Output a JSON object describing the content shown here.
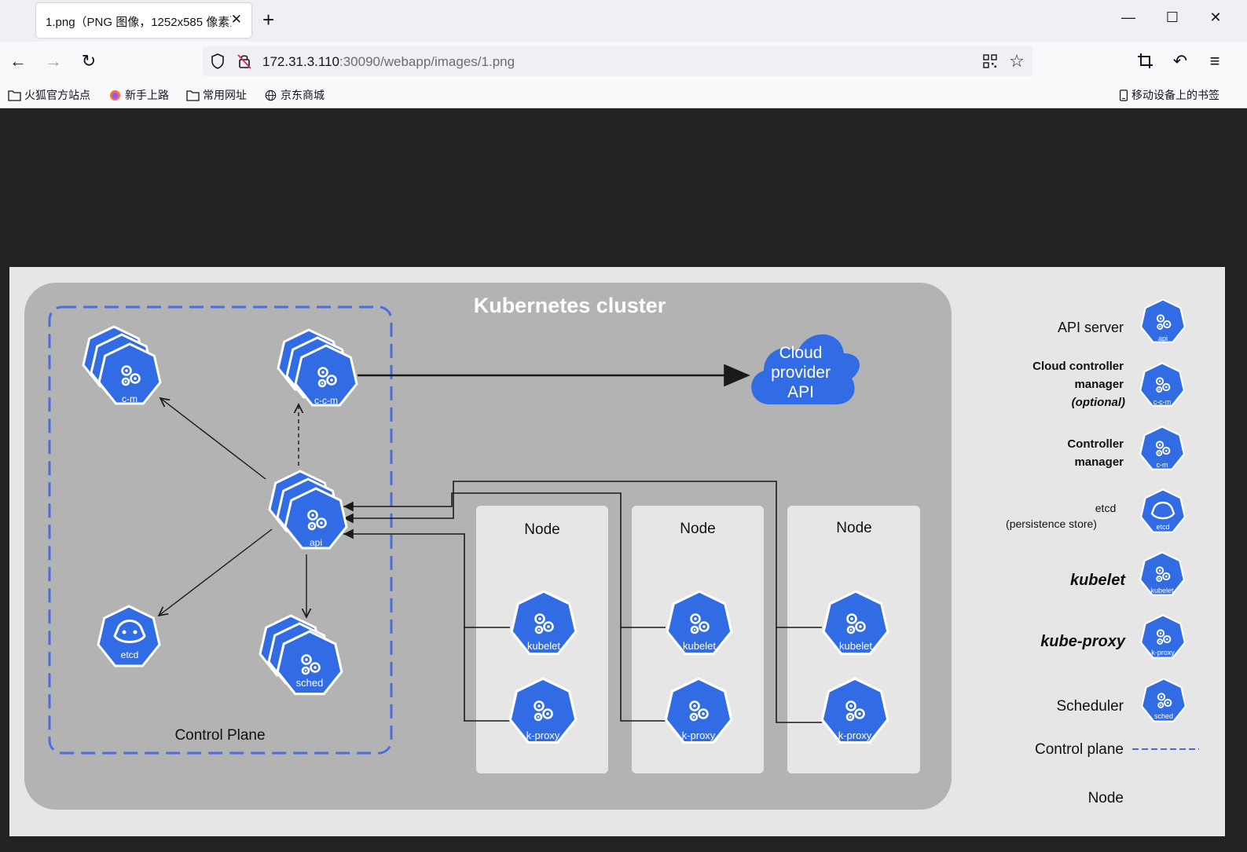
{
  "browser": {
    "tab_title": "1.png（PNG 图像，1252x585 像素）",
    "url_host": "172.31.3.110",
    "url_path": ":30090/webapp/images/1.png",
    "bookmarks": [
      "火狐官方站点",
      "新手上路",
      "常用网址",
      "京东商城"
    ],
    "mobile_bookmarks": "移动设备上的书签"
  },
  "diagram": {
    "cluster_title": "Kubernetes cluster",
    "control_plane_label": "Control Plane",
    "cloud_label": [
      "Cloud",
      "provider",
      "API"
    ],
    "node_label": "Node",
    "components": {
      "cm": "c-m",
      "ccm": "c-c-m",
      "api": "api",
      "etcd": "etcd",
      "sched": "sched",
      "kubelet": "kubelet",
      "kproxy": "k-proxy"
    },
    "legend": {
      "api_server": "API server",
      "ccm_lines": [
        "Cloud controller",
        "manager",
        "(optional)"
      ],
      "cm_lines": [
        "Controller",
        "manager"
      ],
      "etcd_lines": [
        "etcd",
        "(persistence store)"
      ],
      "kubelet": "kubelet",
      "kube_proxy": "kube-proxy",
      "scheduler": "Scheduler",
      "control_plane": "Control plane",
      "node": "Node"
    }
  },
  "colors": {
    "k8s_blue": "#326ce5",
    "cluster_bg": "#b3b3b3",
    "node_bg": "#e6e6e6",
    "dashed_border": "#4a6ee0"
  }
}
